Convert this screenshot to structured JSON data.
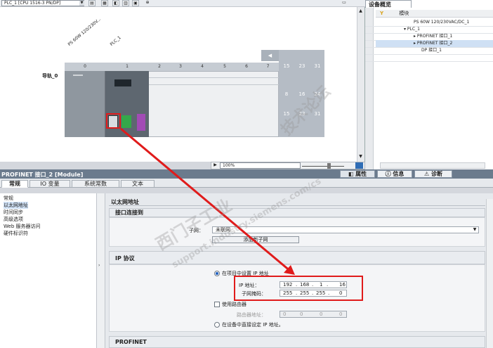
{
  "device_toolbar": {
    "device_select": "PLC_1 [CPU 1516-3 PN/DP]"
  },
  "canvas": {
    "ps_label": "PS 60W 120/230V...",
    "plc_label": "PLC_1",
    "rail_label": "导轨_0",
    "slots": [
      "0",
      "1",
      "2",
      "3",
      "4",
      "5",
      "6",
      "7"
    ],
    "ext_slot_top": [
      "15",
      "23",
      "31"
    ],
    "ext_slot_mid": [
      "8",
      "16",
      "24"
    ],
    "ext_slot_low": [
      "15",
      "23",
      "31"
    ]
  },
  "zoom": {
    "value": "100%"
  },
  "overview": {
    "tab_label": "设备概览",
    "header_label": "模块",
    "rows": [
      "PS 60W 120/230VAC/DC_1",
      "PLC_1",
      "PROFINET 接口_1",
      "PROFINET 接口_2",
      "DP 接口_1"
    ]
  },
  "properties": {
    "title": "PROFINET 接口_2 [Module]",
    "inspector_tabs": [
      "属性",
      "信息",
      "诊断"
    ],
    "tabs": [
      "常规",
      "IO 变量",
      "系统常数",
      "文本"
    ]
  },
  "nav": {
    "items": [
      "常规",
      "以太网地址",
      "时间同步",
      "高级选项",
      "Web 服务器访问",
      "硬件标识符"
    ]
  },
  "ethernet": {
    "heading": "以太网地址",
    "iface_heading": "接口连接到",
    "subnet_label": "子网：",
    "subnet_value": "未联网",
    "add_subnet_button": "添加新子网"
  },
  "ip": {
    "heading": "IP 协议",
    "set_in_project_label": "在项目中设置 IP 地址",
    "ip_label": "IP 地址：",
    "ip_parts": [
      "192",
      "168",
      "1",
      "16"
    ],
    "mask_label": "子网掩码：",
    "mask_parts": [
      "255",
      "255",
      "255",
      "0"
    ],
    "use_router_label": "使用路由器",
    "router_label": "路由器地址：",
    "router_parts": [
      "0",
      "0",
      "0",
      "0"
    ],
    "set_on_device_label": "在设备中直接设定 IP 地址。"
  },
  "profinet": {
    "heading": "PROFINET"
  },
  "watermarks": [
    "西门子工业",
    "support.industry.siemens.com/cs",
    "技术论坛"
  ],
  "colors": {
    "annotation_red": "#e01b1b",
    "title_bar": "#6b7b8d"
  }
}
